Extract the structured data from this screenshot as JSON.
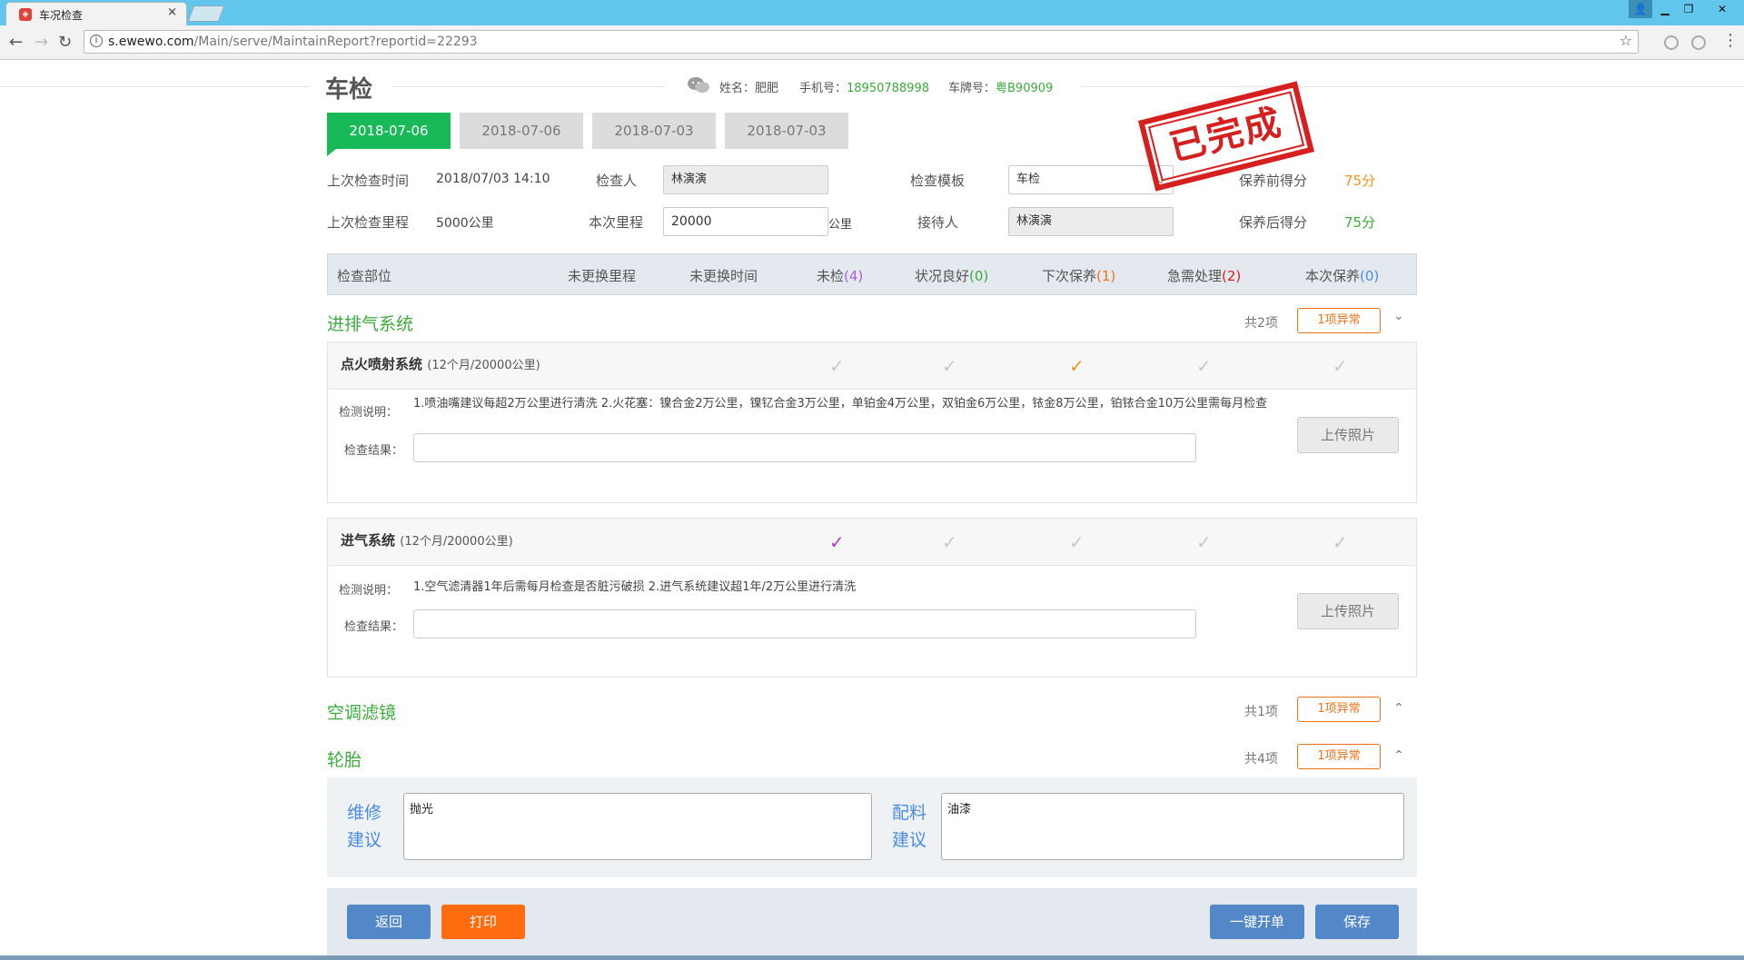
{
  "browser": {
    "tab_title": "车况检查",
    "tab_close": "×",
    "url_host": "s.ewewo.com",
    "url_path": "/Main/serve/MaintainReport?reportid=22293"
  },
  "header": {
    "title": "车检",
    "name_label": "姓名：",
    "name_value": "肥肥",
    "phone_label": "手机号：",
    "phone_value": "18950788998",
    "plate_label": "车牌号：",
    "plate_value": "粤B90909"
  },
  "date_tabs": [
    "2018-07-06",
    "2018-07-06",
    "2018-07-03",
    "2018-07-03"
  ],
  "stamp": "已完成",
  "form": {
    "last_time_label": "上次检查时间",
    "last_time_value": "2018/07/03 14:10",
    "inspector_label": "检查人",
    "inspector_value": "林演演",
    "template_label": "检查模板",
    "template_value": "车检",
    "pre_score_label": "保养前得分",
    "pre_score_value": "75分",
    "last_mileage_label": "上次检查里程",
    "last_mileage_value": "5000公里",
    "mileage_label": "本次里程",
    "mileage_value": "20000",
    "mileage_unit": "公里",
    "receptionist_label": "接待人",
    "receptionist_value": "林演演",
    "post_score_label": "保养后得分",
    "post_score_value": "75分"
  },
  "columns": {
    "part": "检查部位",
    "unchanged_mileage": "未更换里程",
    "unchanged_time": "未更换时间",
    "unchecked": "未检",
    "unchecked_count": "(4)",
    "good": "状况良好",
    "good_count": "(0)",
    "next": "下次保养",
    "next_count": "(1)",
    "urgent": "急需处理",
    "urgent_count": "(2)",
    "current": "本次保养",
    "current_count": "(0)"
  },
  "sections": [
    {
      "title": "进排气系统",
      "count": "共2项",
      "abnormal": "1项异常",
      "chevron": "⌄"
    },
    {
      "title": "空调滤镜",
      "count": "共1项",
      "abnormal": "1项异常",
      "chevron": "⌃"
    },
    {
      "title": "轮胎",
      "count": "共4项",
      "abnormal": "1项异常",
      "chevron": "⌃"
    }
  ],
  "items": [
    {
      "name": "点火喷射系统",
      "cycle": "(12个月/20000公里)",
      "desc_label": "检测说明：",
      "desc": "1.喷油嘴建议每超2万公里进行清洗 2.火花塞：镍合金2万公里，镍钇合金3万公里，单铂金4万公里，双铂金6万公里，铱金8万公里，铂铱合金10万公里需每月检查",
      "result_label": "检查结果：",
      "upload": "上传照片",
      "selected": "下次保养"
    },
    {
      "name": "进气系统",
      "cycle": "(12个月/20000公里)",
      "desc_label": "检测说明：",
      "desc": "1.空气滤清器1年后需每月检查是否脏污破损 2.进气系统建议超1年/2万公里进行清洗",
      "result_label": "检查结果：",
      "upload": "上传照片",
      "selected": "未检"
    }
  ],
  "suggestions": {
    "repair_label": "维修建议",
    "repair_value": "抛光",
    "parts_label": "配料建议",
    "parts_value": "油漆"
  },
  "footer": {
    "back": "返回",
    "print": "打印",
    "one_click": "一键开单",
    "save": "保存"
  },
  "colors": {
    "accent_green": "#18b957",
    "orange": "#f07218",
    "blue": "#5388c8",
    "stamp_red": "#d62020"
  }
}
